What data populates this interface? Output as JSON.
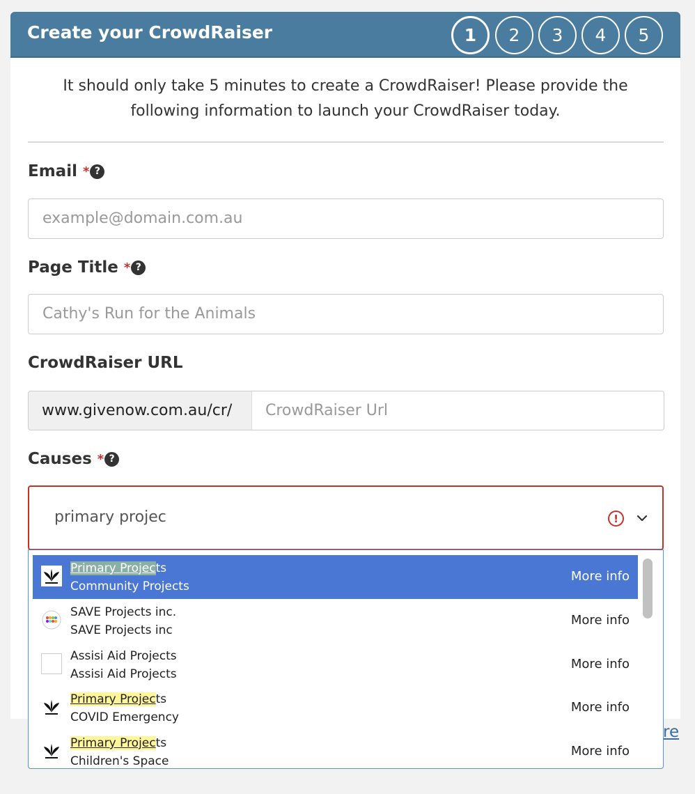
{
  "header": {
    "title": "Create your CrowdRaiser",
    "steps": [
      "1",
      "2",
      "3",
      "4",
      "5"
    ],
    "active_step": 1
  },
  "intro": {
    "line1": "It should only take 5 minutes to create a CrowdRaiser! Please provide the",
    "line2": "following information to launch your CrowdRaiser today."
  },
  "form": {
    "email": {
      "label": "Email",
      "required_mark": "*",
      "help": "?",
      "placeholder": "example@domain.com.au"
    },
    "page_title": {
      "label": "Page Title",
      "required_mark": "*",
      "help": "?",
      "placeholder": "Cathy's Run for the Animals"
    },
    "url": {
      "label": "CrowdRaiser URL",
      "prefix": "www.givenow.com.au/cr/",
      "placeholder": "CrowdRaiser Url"
    },
    "causes": {
      "label": "Causes",
      "required_mark": "*",
      "help": "?",
      "value": "primary projec",
      "error_icon": "!"
    }
  },
  "dropdown": {
    "options": [
      {
        "hl": "Primary Projec",
        "rest": "ts",
        "line2": "Community Projects",
        "more": "More info",
        "icon": "leaf-logo-icon",
        "selected": true
      },
      {
        "hl": "",
        "rest": "SAVE Projects inc.",
        "line2": "SAVE Projects inc",
        "more": "More info",
        "icon": "dots-logo-icon",
        "selected": false
      },
      {
        "hl": "",
        "rest": "Assisi Aid Projects",
        "line2": "Assisi Aid Projects",
        "more": "More info",
        "icon": "blank-logo-icon",
        "selected": false
      },
      {
        "hl": "Primary Projec",
        "rest": "ts",
        "line2": "COVID Emergency",
        "more": "More info",
        "icon": "leaf-logo-icon",
        "selected": false
      },
      {
        "hl": "Primary Projec",
        "rest": "ts",
        "line2": "Children's Space",
        "more": "More info",
        "icon": "leaf-logo-icon",
        "selected": false
      }
    ]
  },
  "background_link": "re",
  "colors": {
    "header": "#4a7c9f",
    "selected": "#4a76d4",
    "error": "#c9302c",
    "highlight": "#fff59a"
  }
}
